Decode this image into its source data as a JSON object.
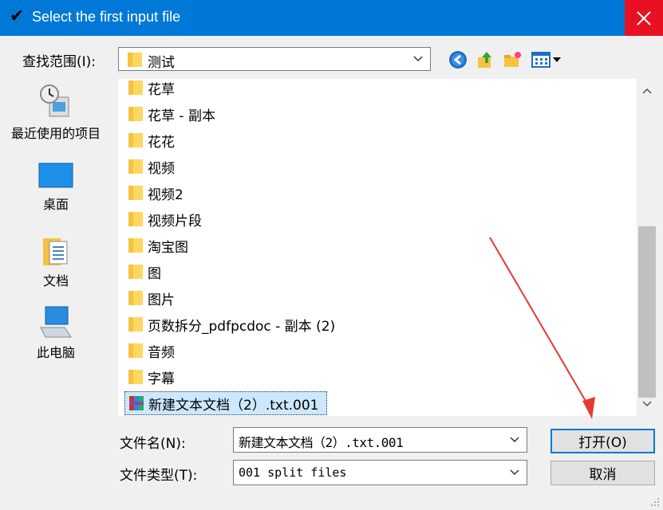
{
  "window": {
    "title": "Select the first input file",
    "close_glyph": "✕"
  },
  "look_in": {
    "label": "查找范围(I):",
    "value": "测试"
  },
  "places": [
    {
      "label": "最近使用的项目",
      "icon": "recent-items-icon"
    },
    {
      "label": "桌面",
      "icon": "desktop-icon"
    },
    {
      "label": "文档",
      "icon": "documents-icon"
    },
    {
      "label": "此电脑",
      "icon": "this-pc-icon"
    }
  ],
  "files": [
    {
      "name": "花草",
      "type": "folder"
    },
    {
      "name": "花草 - 副本",
      "type": "folder"
    },
    {
      "name": "花花",
      "type": "folder"
    },
    {
      "name": "视频",
      "type": "folder"
    },
    {
      "name": "视频2",
      "type": "folder"
    },
    {
      "name": "视频片段",
      "type": "folder"
    },
    {
      "name": "淘宝图",
      "type": "folder"
    },
    {
      "name": "图",
      "type": "folder"
    },
    {
      "name": "图片",
      "type": "folder"
    },
    {
      "name": "页数拆分_pdfpcdoc - 副本 (2)",
      "type": "folder"
    },
    {
      "name": "音频",
      "type": "folder"
    },
    {
      "name": "字幕",
      "type": "folder"
    },
    {
      "name": "新建文本文档（2）.txt.001",
      "type": "archive",
      "selected": true
    }
  ],
  "file_name": {
    "label": "文件名(N):",
    "value": "新建文本文档（2）.txt.001"
  },
  "file_type": {
    "label": "文件类型(T):",
    "value": "001 split files"
  },
  "buttons": {
    "open": "打开(O)",
    "cancel": "取消"
  },
  "colors": {
    "titlebar": "#0078d7",
    "close": "#e81123",
    "selection": "#cce8ff",
    "annotation_arrow": "#e53935"
  }
}
